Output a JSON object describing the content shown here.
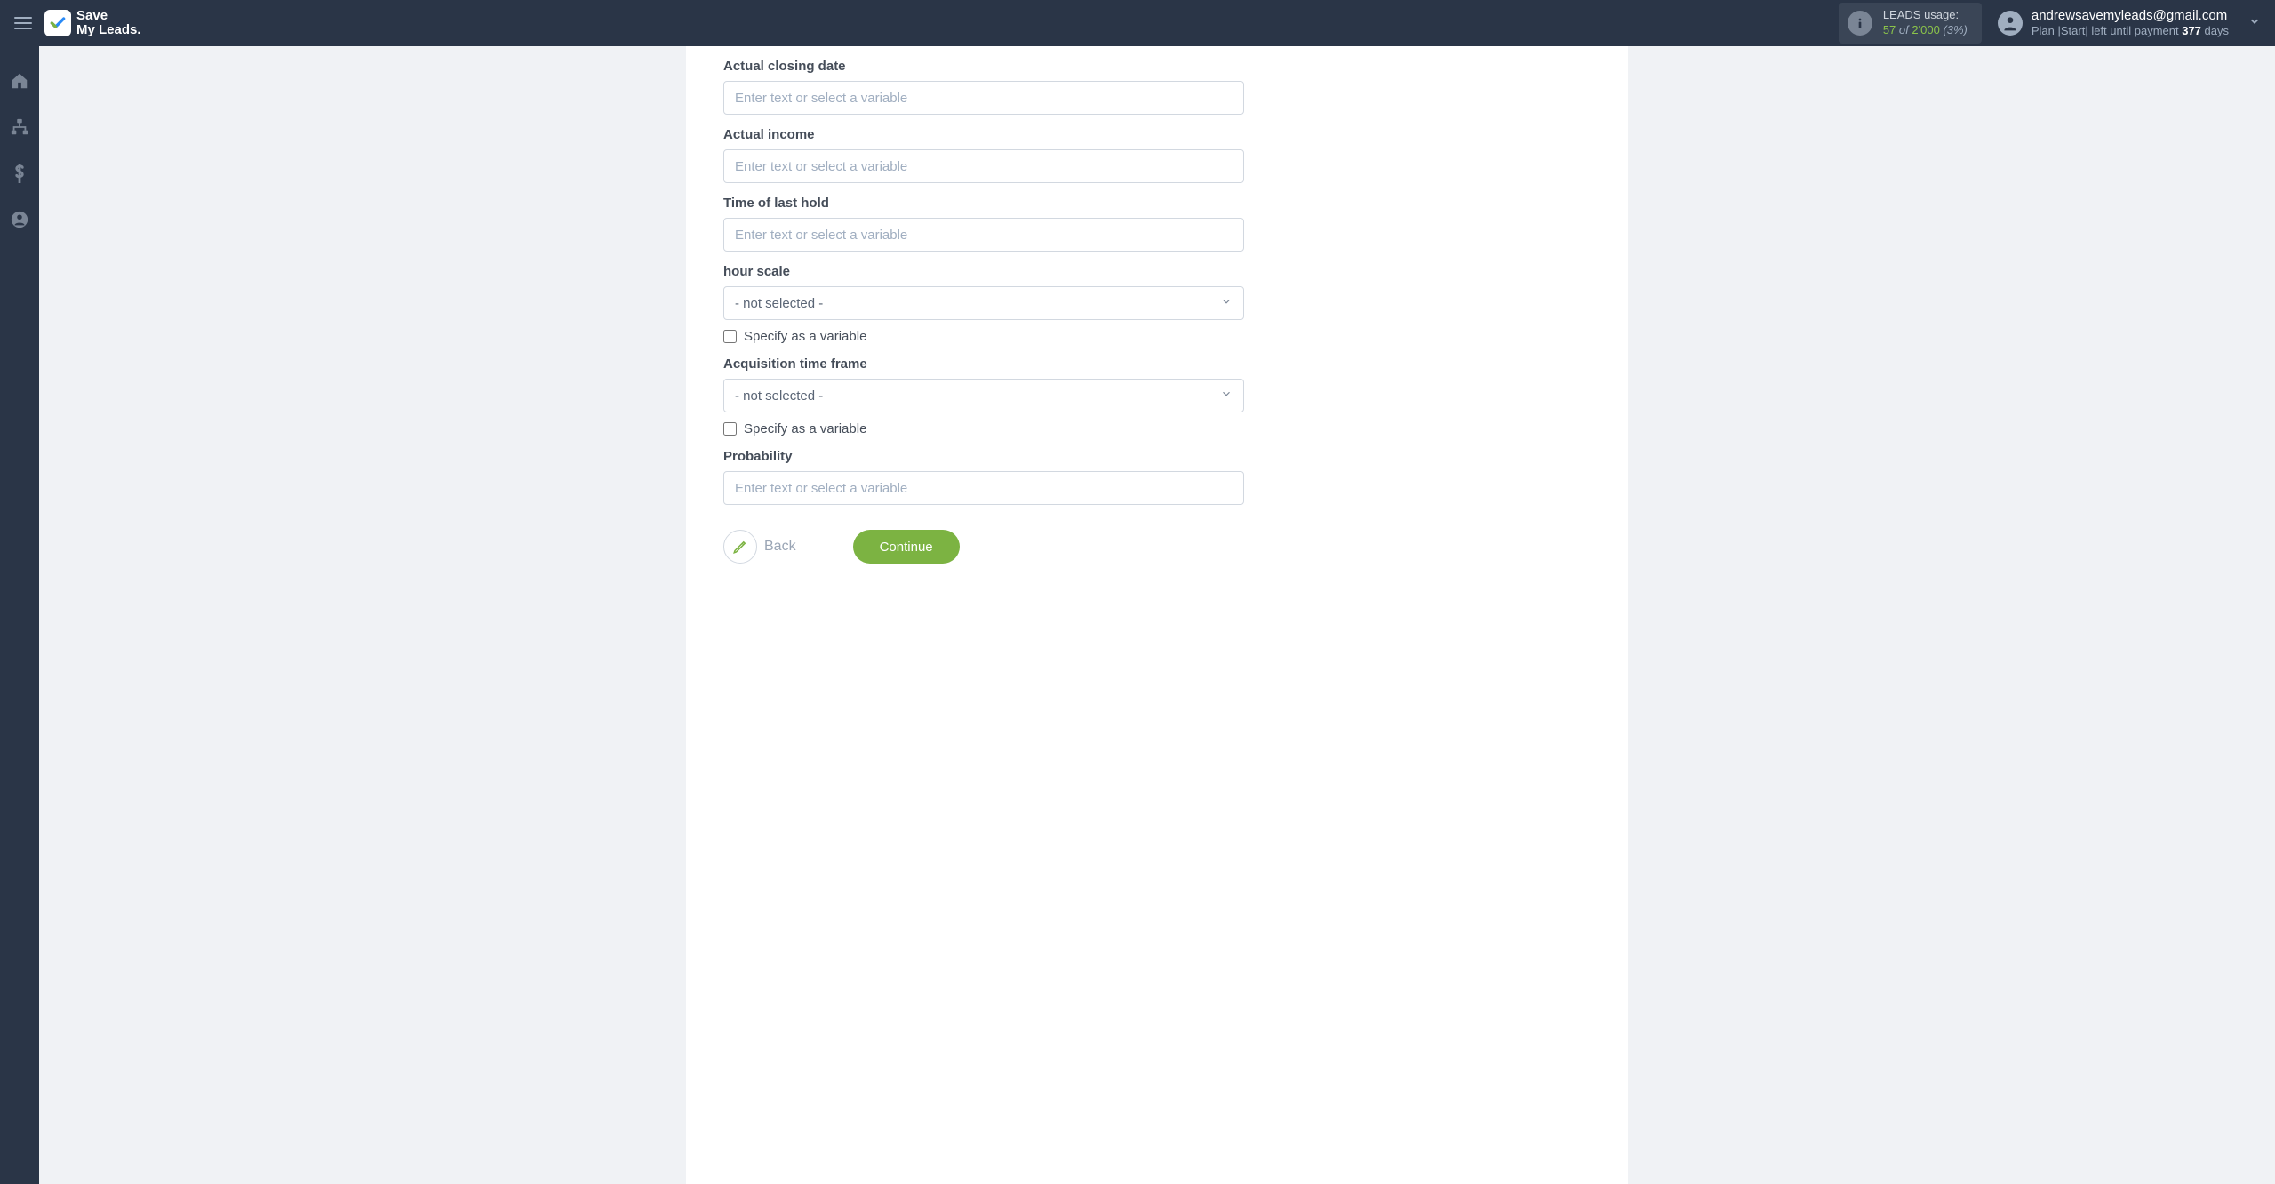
{
  "header": {
    "logo_line1": "Save",
    "logo_line2": "My Leads.",
    "usage_label": "LEADS usage:",
    "usage_count": "57",
    "usage_of": "of",
    "usage_limit": "2'000",
    "usage_pct": "(3%)",
    "user_email": "andrewsavemyleads@gmail.com",
    "plan_prefix": "Plan |Start| left until payment ",
    "plan_days": "377",
    "plan_suffix": " days"
  },
  "fields": {
    "actual_closing_date": {
      "label": "Actual closing date",
      "placeholder": "Enter text or select a variable"
    },
    "actual_income": {
      "label": "Actual income",
      "placeholder": "Enter text or select a variable"
    },
    "time_last_hold": {
      "label": "Time of last hold",
      "placeholder": "Enter text or select a variable"
    },
    "hour_scale": {
      "label": "hour scale",
      "selected": "- not selected -",
      "specify": "Specify as a variable"
    },
    "acquisition_time_frame": {
      "label": "Acquisition time frame",
      "selected": "- not selected -",
      "specify": "Specify as a variable"
    },
    "probability": {
      "label": "Probability",
      "placeholder": "Enter text or select a variable"
    }
  },
  "actions": {
    "back": "Back",
    "continue": "Continue"
  }
}
